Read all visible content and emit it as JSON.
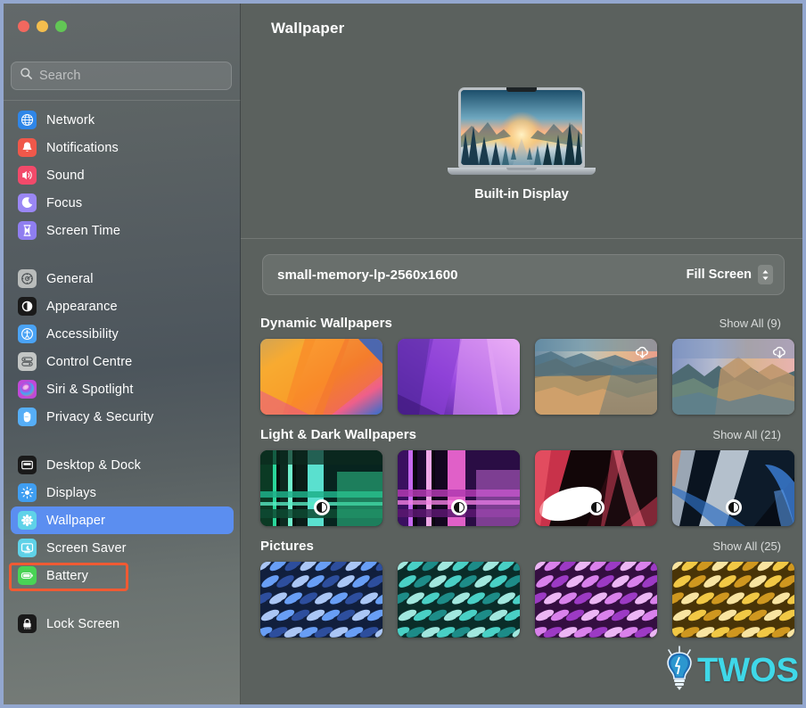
{
  "window": {
    "title": "Wallpaper",
    "traffic_lights": [
      "close",
      "minimize",
      "zoom"
    ],
    "accent_blue": "#5b8ef0",
    "annotation_color": "#f05a33",
    "border_color": "#93a7cf"
  },
  "search": {
    "placeholder": "Search",
    "value": "",
    "icon": "search-icon"
  },
  "sidebar": {
    "groups": [
      {
        "items": [
          {
            "label": "Network",
            "icon": "globe-icon",
            "icon_bg": "#2f86e8",
            "selected": false
          },
          {
            "label": "Notifications",
            "icon": "bell-icon",
            "icon_bg": "#f0584a",
            "selected": false
          },
          {
            "label": "Sound",
            "icon": "speaker-icon",
            "icon_bg": "#f24a6a",
            "selected": false
          },
          {
            "label": "Focus",
            "icon": "moon-icon",
            "icon_bg": "#9a87f5",
            "selected": false
          },
          {
            "label": "Screen Time",
            "icon": "hourglass-icon",
            "icon_bg": "#8f7ef0",
            "selected": false
          }
        ]
      },
      {
        "items": [
          {
            "label": "General",
            "icon": "gear-icon",
            "icon_bg": "#b9bcbb",
            "selected": false
          },
          {
            "label": "Appearance",
            "icon": "contrast-icon",
            "icon_bg": "#1a1a1a",
            "selected": false
          },
          {
            "label": "Accessibility",
            "icon": "person-icon",
            "icon_bg": "#4aa3f5",
            "selected": false
          },
          {
            "label": "Control Centre",
            "icon": "toggles-icon",
            "icon_bg": "#c3c6c5",
            "selected": false
          },
          {
            "label": "Siri & Spotlight",
            "icon": "siri-orb-icon",
            "icon_bg": "#c049d8",
            "selected": false
          },
          {
            "label": "Privacy & Security",
            "icon": "hand-icon",
            "icon_bg": "#56aef7",
            "selected": false
          }
        ]
      },
      {
        "items": [
          {
            "label": "Desktop & Dock",
            "icon": "desktop-icon",
            "icon_bg": "#1a1a1a",
            "selected": false
          },
          {
            "label": "Displays",
            "icon": "brightness-icon",
            "icon_bg": "#3f9ef2",
            "selected": false
          },
          {
            "label": "Wallpaper",
            "icon": "flower-icon",
            "icon_bg": "#5fd2e8",
            "selected": true
          },
          {
            "label": "Screen Saver",
            "icon": "screensaver-icon",
            "icon_bg": "#5fd2e8",
            "selected": false
          },
          {
            "label": "Battery",
            "icon": "battery-icon",
            "icon_bg": "#49d355",
            "selected": false
          }
        ]
      },
      {
        "items": [
          {
            "label": "Lock Screen",
            "icon": "lock-icon",
            "icon_bg": "#1a1a1a",
            "selected": false
          }
        ]
      }
    ]
  },
  "main": {
    "title": "Wallpaper",
    "display": {
      "label": "Built-in Display",
      "preview_description": "forest-sunset-wallpaper"
    },
    "current": {
      "wallpaper_name": "small-memory-lp-2560x1600",
      "fit_mode": "Fill Screen",
      "fit_icon": "chevron-updown-icon"
    },
    "sections": [
      {
        "title": "Dynamic Wallpapers",
        "show_all": "Show All (9)",
        "thumbs": [
          {
            "name": "ventura-orange",
            "badge": "none",
            "art": "dyn1"
          },
          {
            "name": "monterey-purple",
            "badge": "none",
            "art": "dyn2"
          },
          {
            "name": "big-sur-coast",
            "badge": "cloud",
            "art": "dyn3"
          },
          {
            "name": "catalina-island",
            "badge": "cloud",
            "art": "dyn4"
          },
          {
            "name": "partial-next",
            "badge": "none",
            "art": "dyn5"
          }
        ]
      },
      {
        "title": "Light & Dark Wallpapers",
        "show_all": "Show All (21)",
        "thumbs": [
          {
            "name": "ld-green-teal",
            "badge": "halfmoon",
            "art": "ld1"
          },
          {
            "name": "ld-magenta",
            "badge": "halfmoon",
            "art": "ld2"
          },
          {
            "name": "ld-red-white",
            "badge": "halfmoon",
            "art": "ld3"
          },
          {
            "name": "ld-blue-silver",
            "badge": "halfmoon",
            "art": "ld4"
          },
          {
            "name": "ld-partial",
            "badge": "none",
            "art": "ld5"
          }
        ]
      },
      {
        "title": "Pictures",
        "show_all": "Show All (25)",
        "thumbs": [
          {
            "name": "feather-blue",
            "badge": "none",
            "art": "pic1"
          },
          {
            "name": "feather-teal",
            "badge": "none",
            "art": "pic2"
          },
          {
            "name": "feather-pink",
            "badge": "none",
            "art": "pic3"
          },
          {
            "name": "feather-yellow",
            "badge": "none",
            "art": "pic4"
          },
          {
            "name": "feather-orange",
            "badge": "none",
            "art": "pic5"
          }
        ]
      }
    ]
  },
  "watermark": {
    "text": "TWOS",
    "icon": "lightbulb-icon",
    "color": "#3fd8e8"
  }
}
